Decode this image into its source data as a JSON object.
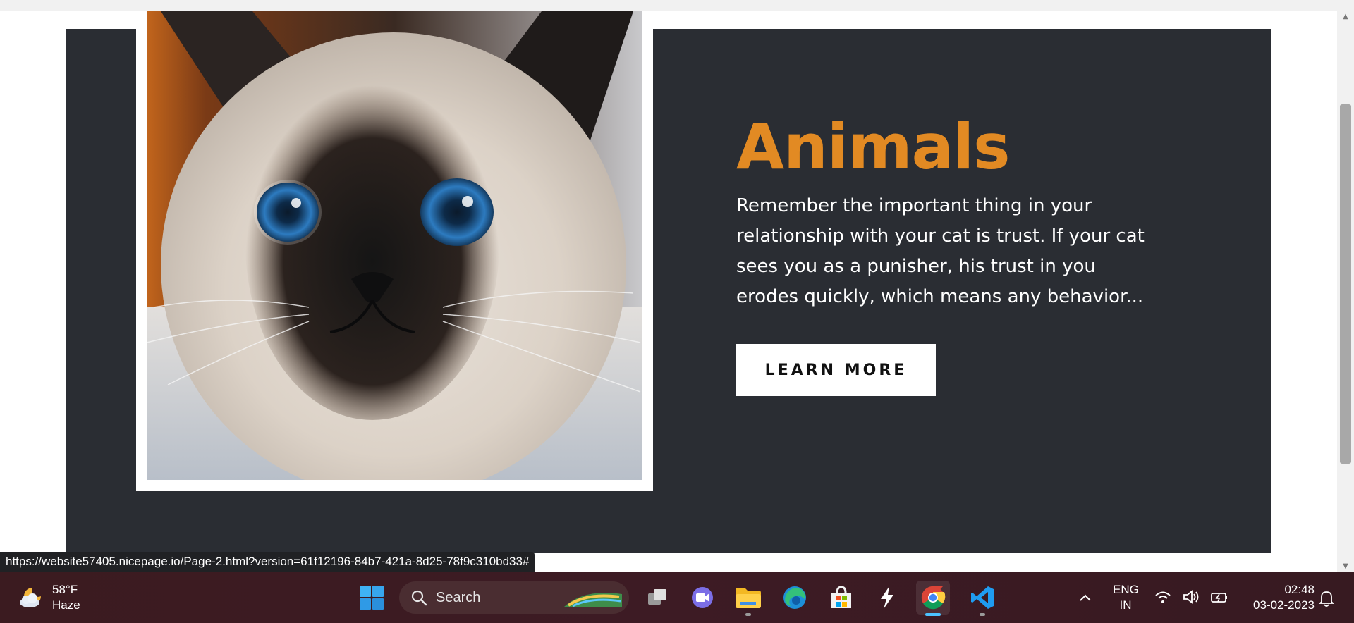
{
  "page": {
    "heading": "Animals",
    "body": "Remember the important thing in your relationship with your cat is trust. If your cat sees you as a punisher, his trust in you erodes quickly, which means any behavior...",
    "button_label": "LEARN MORE"
  },
  "status_bar": {
    "url": "https://website57405.nicepage.io/Page-2.html?version=61f12196-84b7-421a-8d25-78f9c310bd33#"
  },
  "taskbar": {
    "weather": {
      "temp": "58°F",
      "condition": "Haze",
      "icon": "cloud-moon-icon"
    },
    "search_label": "Search",
    "apps": [
      {
        "name": "start",
        "icon": "windows-icon"
      },
      {
        "name": "task-view",
        "icon": "task-view-icon"
      },
      {
        "name": "teams",
        "icon": "teams-chat-icon"
      },
      {
        "name": "file-explorer",
        "icon": "folder-icon"
      },
      {
        "name": "edge",
        "icon": "edge-icon"
      },
      {
        "name": "store",
        "icon": "store-icon"
      },
      {
        "name": "app",
        "icon": "lightning-icon"
      },
      {
        "name": "chrome",
        "icon": "chrome-icon"
      },
      {
        "name": "vscode",
        "icon": "vscode-icon"
      }
    ],
    "language": {
      "line1": "ENG",
      "line2": "IN"
    },
    "clock": {
      "time": "02:48",
      "date": "03-02-2023"
    }
  },
  "colors": {
    "section_bg": "#2a2d33",
    "heading": "#e28a23",
    "taskbar": "#3b1b20"
  }
}
